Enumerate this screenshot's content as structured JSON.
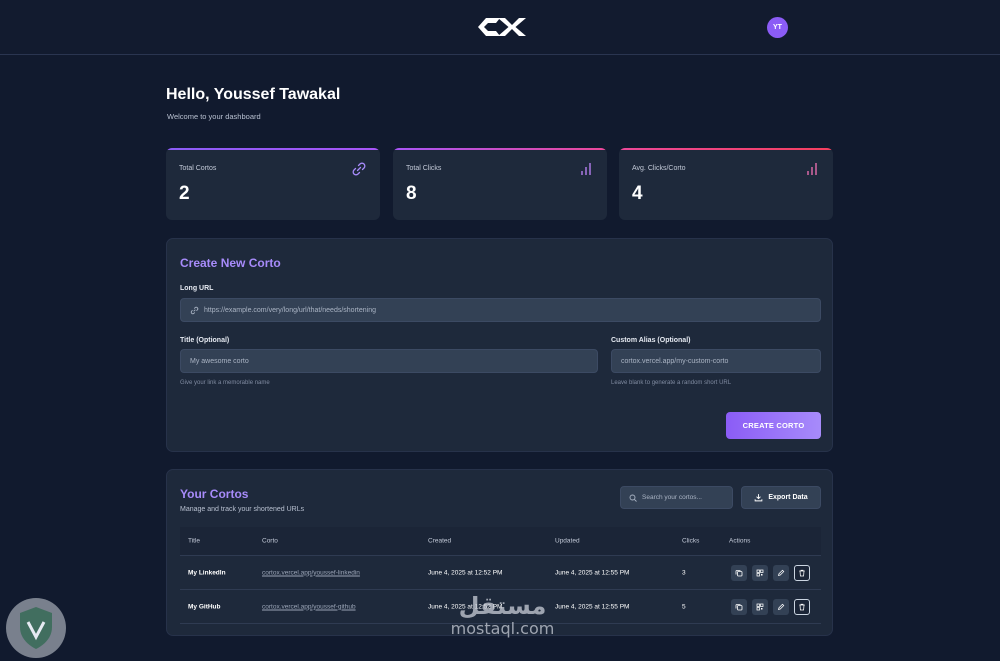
{
  "header": {
    "avatar_initials": "YT",
    "logo": "cortox-logo-icon"
  },
  "welcome": {
    "title": "Hello, Youssef Tawakal",
    "subtitle": "Welcome to your dashboard"
  },
  "stats": [
    {
      "label": "Total Cortos",
      "value": "2",
      "icon": "link-icon"
    },
    {
      "label": "Total Clicks",
      "value": "8",
      "icon": "bar-chart-icon"
    },
    {
      "label": "Avg. Clicks/Corto",
      "value": "4",
      "icon": "bar-chart-icon"
    }
  ],
  "create": {
    "title": "Create New Corto",
    "long_url_label": "Long URL",
    "long_url_placeholder": "https://example.com/very/long/url/that/needs/shortening",
    "title_label": "Title (Optional)",
    "title_placeholder": "My awesome corto",
    "title_hint": "Give your link a memorable name",
    "alias_label": "Custom Alias (Optional)",
    "alias_placeholder": "cortox.vercel.app/my-custom-corto",
    "alias_hint": "Leave blank to generate a random short URL",
    "submit_label": "CREATE CORTO"
  },
  "cortos": {
    "title": "Your Cortos",
    "subtitle": "Manage and track your shortened URLs",
    "search_placeholder": "Search your cortos...",
    "export_label": "Export Data",
    "columns": [
      "Title",
      "Corto",
      "Created",
      "Updated",
      "Clicks",
      "Actions"
    ],
    "rows": [
      {
        "title": "My LinkedIn",
        "corto": "cortox.vercel.app/youssef-linkedin",
        "created": "June 4, 2025 at 12:52 PM",
        "updated": "June 4, 2025 at 12:55 PM",
        "clicks": "3"
      },
      {
        "title": "My GitHub",
        "corto": "cortox.vercel.app/youssef-github",
        "created": "June 4, 2025 at 12:52 PM",
        "updated": "June 4, 2025 at 12:55 PM",
        "clicks": "5"
      }
    ]
  },
  "watermark": {
    "arabic": "مستقل",
    "latin": "mostaql.com"
  },
  "colors": {
    "accent": "#8b5cf6",
    "background": "#111a2e",
    "card": "#1e293b"
  }
}
